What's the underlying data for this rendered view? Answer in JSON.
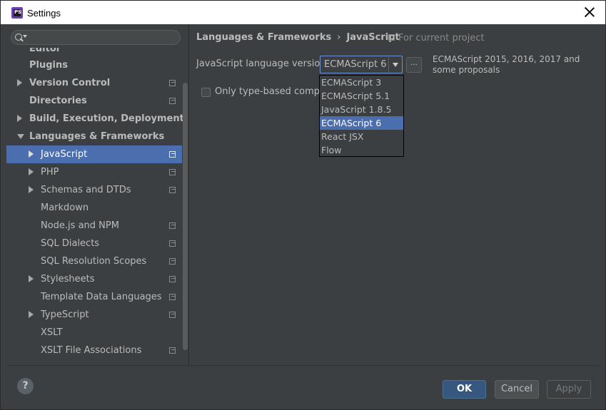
{
  "window": {
    "title": "Settings"
  },
  "search": {
    "placeholder": ""
  },
  "tree": {
    "items": [
      {
        "label": "Editor",
        "level": 0,
        "expander": "none",
        "project": false,
        "selected": false,
        "partial": true
      },
      {
        "label": "Plugins",
        "level": 0,
        "expander": "none",
        "project": false,
        "selected": false
      },
      {
        "label": "Version Control",
        "level": 0,
        "expander": "collapsed",
        "project": true,
        "selected": false
      },
      {
        "label": "Directories",
        "level": 0,
        "expander": "none",
        "project": true,
        "selected": false
      },
      {
        "label": "Build, Execution, Deployment",
        "level": 0,
        "expander": "collapsed",
        "project": false,
        "selected": false
      },
      {
        "label": "Languages & Frameworks",
        "level": 0,
        "expander": "expanded",
        "project": false,
        "selected": false
      },
      {
        "label": "JavaScript",
        "level": 1,
        "expander": "collapsed",
        "project": true,
        "selected": true
      },
      {
        "label": "PHP",
        "level": 1,
        "expander": "collapsed",
        "project": true,
        "selected": false
      },
      {
        "label": "Schemas and DTDs",
        "level": 1,
        "expander": "collapsed",
        "project": true,
        "selected": false
      },
      {
        "label": "Markdown",
        "level": 1,
        "expander": "none",
        "project": false,
        "selected": false
      },
      {
        "label": "Node.js and NPM",
        "level": 1,
        "expander": "none",
        "project": true,
        "selected": false
      },
      {
        "label": "SQL Dialects",
        "level": 1,
        "expander": "none",
        "project": true,
        "selected": false
      },
      {
        "label": "SQL Resolution Scopes",
        "level": 1,
        "expander": "none",
        "project": true,
        "selected": false
      },
      {
        "label": "Stylesheets",
        "level": 1,
        "expander": "collapsed",
        "project": true,
        "selected": false
      },
      {
        "label": "Template Data Languages",
        "level": 1,
        "expander": "none",
        "project": true,
        "selected": false
      },
      {
        "label": "TypeScript",
        "level": 1,
        "expander": "collapsed",
        "project": true,
        "selected": false
      },
      {
        "label": "XSLT",
        "level": 1,
        "expander": "none",
        "project": false,
        "selected": false
      },
      {
        "label": "XSLT File Associations",
        "level": 1,
        "expander": "none",
        "project": true,
        "selected": false
      }
    ]
  },
  "breadcrumb": {
    "parent": "Languages & Frameworks",
    "separator": "›",
    "current": "JavaScript"
  },
  "scope": {
    "label": "For current project"
  },
  "language_version": {
    "label": "JavaScript language version",
    "selected": "ECMAScript 6",
    "more_button": "...",
    "description": "ECMAScript 2015, 2016, 2017 and some proposals",
    "options": [
      "ECMAScript 3",
      "ECMAScript 5.1",
      "JavaScript 1.8.5",
      "ECMAScript 6",
      "React JSX",
      "Flow"
    ],
    "highlighted_index": 3
  },
  "only_type_based": {
    "label": "Only type-based complet",
    "checked": false
  },
  "buttons": {
    "help": "?",
    "ok": "OK",
    "cancel": "Cancel",
    "apply": "Apply"
  },
  "colors": {
    "background": "#3c3f41",
    "selection": "#4b6eaf",
    "ok_button": "#365880"
  }
}
